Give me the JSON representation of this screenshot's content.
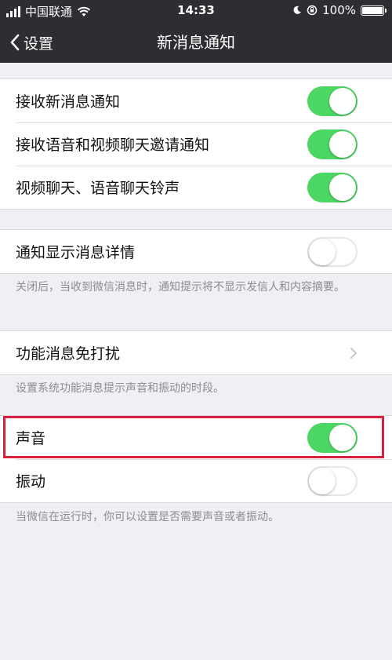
{
  "status_bar": {
    "carrier": "中国联通",
    "time": "14:33",
    "battery": "100%",
    "battery_level": 1.0
  },
  "nav": {
    "back_label": "设置",
    "title": "新消息通知"
  },
  "group1": [
    {
      "label": "接收新消息通知",
      "on": true
    },
    {
      "label": "接收语音和视频聊天邀请通知",
      "on": true
    },
    {
      "label": "视频聊天、语音聊天铃声",
      "on": true
    }
  ],
  "group2": {
    "label": "通知显示消息详情",
    "on": false,
    "note": "关闭后，当收到微信消息时，通知提示将不显示发信人和内容摘要。"
  },
  "group3": {
    "label": "功能消息免打扰",
    "note": "设置系统功能消息提示声音和振动的时段。"
  },
  "group4": [
    {
      "label": "声音",
      "on": true
    },
    {
      "label": "振动",
      "on": false
    }
  ],
  "group4_note": "当微信在运行时，你可以设置是否需要声音或者振动。",
  "colors": {
    "switch_on": "#4cd764",
    "nav_bg": "#2e2e32",
    "highlight": "#d6203f"
  },
  "icons": {
    "back": "chevron-left-icon",
    "disclosure": "chevron-right-icon",
    "wifi": "wifi-icon",
    "battery": "battery-icon",
    "orientation_lock": "orientation-lock-icon",
    "moon": "moon-icon"
  }
}
